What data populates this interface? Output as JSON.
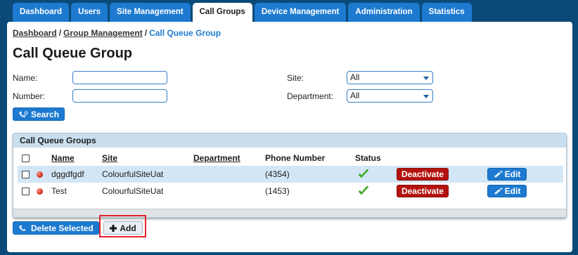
{
  "nav": {
    "tabs": [
      {
        "label": "Dashboard"
      },
      {
        "label": "Users"
      },
      {
        "label": "Site Management"
      },
      {
        "label": "Call Groups"
      },
      {
        "label": "Device Management"
      },
      {
        "label": "Administration"
      },
      {
        "label": "Statistics"
      }
    ],
    "active_tab": "Call Groups"
  },
  "breadcrumb": {
    "items": [
      "Dashboard",
      "Group Management",
      "Call Queue Group"
    ],
    "separator": "/"
  },
  "page_title": "Call Queue Group",
  "filters": {
    "name_label": "Name:",
    "name_value": "",
    "number_label": "Number:",
    "number_value": "",
    "site_label": "Site:",
    "site_value": "All",
    "department_label": "Department:",
    "department_value": "All",
    "search_label": "Search"
  },
  "grid": {
    "title": "Call Queue Groups",
    "columns": {
      "name": "Name",
      "site": "Site",
      "department": "Department",
      "phone": "Phone Number",
      "status": "Status"
    },
    "rows": [
      {
        "name": "dggdfgdf",
        "site": "ColourfulSiteUat",
        "department": "",
        "phone": "(4354)",
        "deactivate_label": "Deactivate",
        "edit_label": "Edit"
      },
      {
        "name": "Test",
        "site": "ColourfulSiteUat",
        "department": "",
        "phone": "(1453)",
        "deactivate_label": "Deactivate",
        "edit_label": "Edit"
      }
    ]
  },
  "actions": {
    "delete_selected_label": "Delete Selected",
    "add_label": "Add"
  },
  "colors": {
    "frame": "#0b4a78",
    "tab_blue": "#1d7ad0",
    "grid_header": "#c9dff0",
    "selected_row": "#d3e6f5",
    "deactivate_red": "#b3130e",
    "status_green": "#3cb521",
    "highlight_red": "#e0232d"
  },
  "icons": {
    "search": "phone-search-icon",
    "row_status": "red-status-dot-icon",
    "active_status": "check-mark-icon",
    "edit": "edit-phone-icon",
    "delete": "phone-delete-icon",
    "add": "plus-icon"
  }
}
